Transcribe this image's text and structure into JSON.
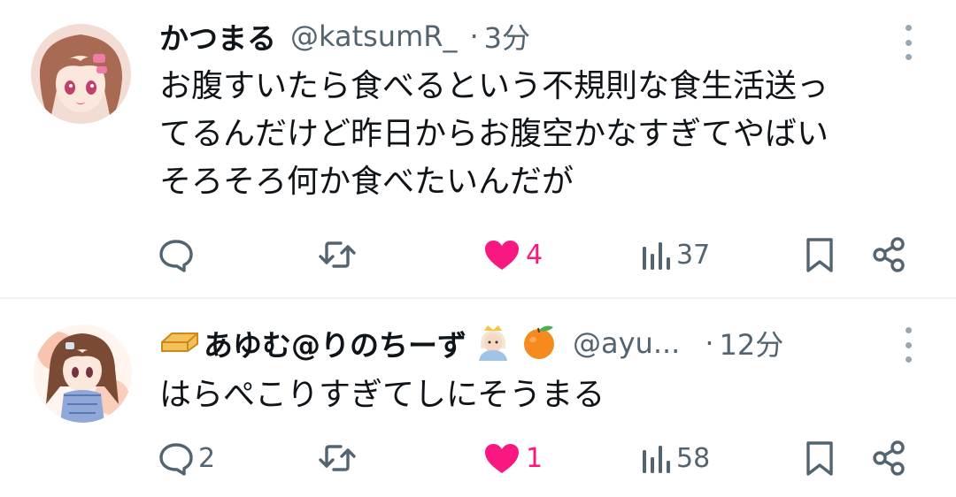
{
  "tweets": [
    {
      "display_name": "かつまる",
      "handle": "@katsumR_",
      "separator": "·",
      "time": "3分",
      "text_lines": [
        "お腹すいたら食べるという不規則な食生活送っ",
        "てるんだけど昨日からお腹空かなすぎてやばい",
        "そろそろ何か食べたいんだが"
      ],
      "replies": "",
      "retweets": "",
      "likes": "4",
      "liked": true,
      "views": "37"
    },
    {
      "display_name": "あゆむ@りのちーず",
      "name_prefix_icon": "envelope-emoji-icon",
      "name_suffix_icons": [
        "princess-emoji-icon",
        "tangerine-emoji-icon"
      ],
      "handle": "@ayu...",
      "separator": "·",
      "time": "12分",
      "text_lines": [
        "はらぺこりすぎてしにそうまる"
      ],
      "replies": "2",
      "retweets": "",
      "likes": "1",
      "liked": true,
      "views": "58"
    }
  ],
  "colors": {
    "text": "#0f1419",
    "secondary": "#536471",
    "like": "#f91880",
    "divider": "#eff3f4",
    "orange": "#f5a04a"
  }
}
